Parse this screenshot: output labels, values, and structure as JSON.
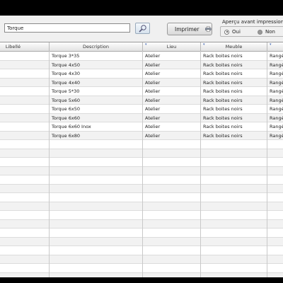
{
  "search": {
    "value": "Torque"
  },
  "print": {
    "label": "Imprimer"
  },
  "preview": {
    "label": "Aperçu avant impression ?",
    "options": [
      {
        "label": "Oui",
        "selected": true
      },
      {
        "label": "Non",
        "selected": false
      }
    ]
  },
  "table": {
    "columns": [
      {
        "label": "Libellé",
        "sortable": false
      },
      {
        "label": "Description",
        "sortable": false
      },
      {
        "label": "Lieu",
        "sortable": true
      },
      {
        "label": "Meuble",
        "sortable": true
      },
      {
        "label": "",
        "sortable": true
      }
    ],
    "rows": [
      [
        "",
        "Torque 3*35",
        "Atelier",
        "Rack boites noirs",
        "Rangé"
      ],
      [
        "",
        "Torque 4x50",
        "Atelier",
        "Rack boites noirs",
        "Rangé"
      ],
      [
        "",
        "Torque 4x30",
        "Atelier",
        "Rack boites noirs",
        "Rangé"
      ],
      [
        "",
        "Torque 4x40",
        "Atelier",
        "Rack boites noirs",
        "Rangé"
      ],
      [
        "",
        "Torque 5*30",
        "Atelier",
        "Rack boites noirs",
        "Rangé"
      ],
      [
        "",
        "Torque 5x60",
        "Atelier",
        "Rack boites noirs",
        "Rangé"
      ],
      [
        "",
        "Torque 6x50",
        "Atelier",
        "Rack boites noirs",
        "Rangé"
      ],
      [
        "",
        "Torque 6x60",
        "Atelier",
        "Rack boites noirs",
        "Rangé"
      ],
      [
        "",
        "Torque 6x60 Inox",
        "Atelier",
        "Rack boites noirs",
        "Rangé"
      ],
      [
        "",
        "Torque 6x80",
        "Atelier",
        "Rack boites noirs",
        "Rangé"
      ]
    ],
    "empty_rows": 17
  }
}
